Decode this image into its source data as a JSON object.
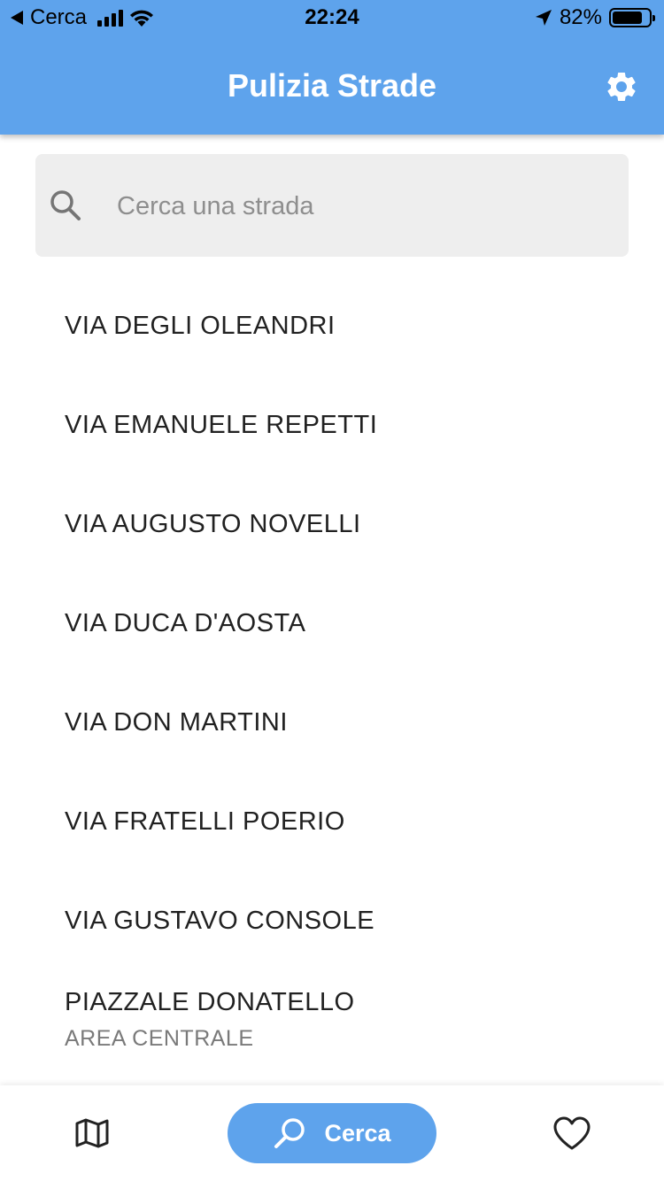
{
  "status_bar": {
    "back_label": "Cerca",
    "time": "22:24",
    "battery_percent": "82%",
    "battery_level": 0.82
  },
  "app_bar": {
    "title": "Pulizia Strade",
    "settings_icon": "gear-icon",
    "background_color": "#5EA3EC"
  },
  "search": {
    "placeholder": "Cerca una strada",
    "value": "",
    "icon": "search-icon"
  },
  "streets": [
    {
      "name": "VIA DEGLI OLEANDRI",
      "subtitle": ""
    },
    {
      "name": "VIA EMANUELE REPETTI",
      "subtitle": ""
    },
    {
      "name": "VIA AUGUSTO NOVELLI",
      "subtitle": ""
    },
    {
      "name": "VIA DUCA D'AOSTA",
      "subtitle": ""
    },
    {
      "name": "VIA DON MARTINI",
      "subtitle": ""
    },
    {
      "name": "VIA FRATELLI POERIO",
      "subtitle": ""
    },
    {
      "name": "VIA GUSTAVO CONSOLE",
      "subtitle": ""
    },
    {
      "name": "PIAZZALE DONATELLO",
      "subtitle": "AREA CENTRALE"
    }
  ],
  "bottom_nav": {
    "map_icon": "map-icon",
    "search_label": "Cerca",
    "search_icon": "search-icon",
    "favorites_icon": "heart-icon",
    "active_color": "#5EA3EC"
  }
}
